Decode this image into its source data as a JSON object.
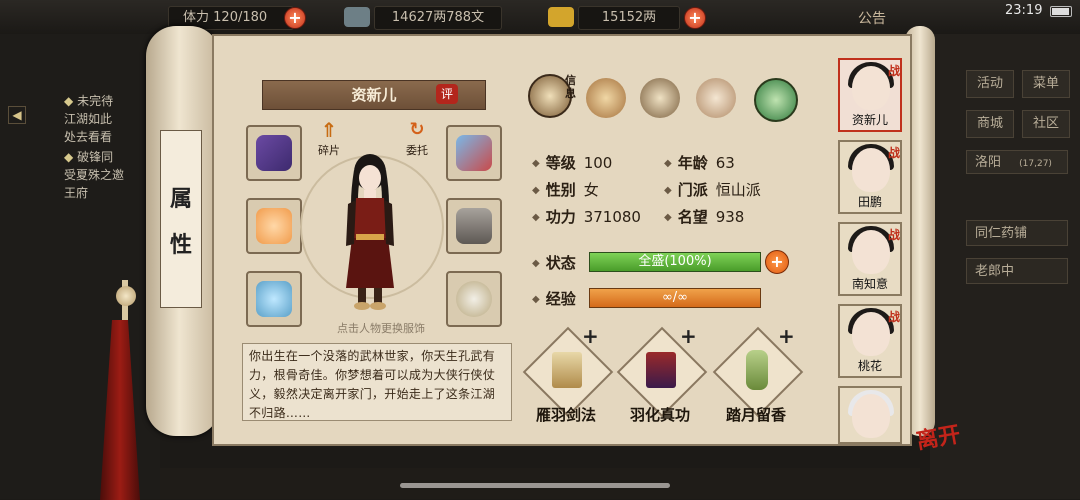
{
  "topbar": {
    "stamina_label": "体力",
    "stamina_value": "120/180",
    "silver_value": "14627两788文",
    "gold_value": "15152两",
    "notice_label": "公告",
    "clock": "23:19"
  },
  "quests": [
    {
      "title": "未完待",
      "desc": [
        "江湖如此",
        "处去看看"
      ]
    },
    {
      "title": "破锋同",
      "desc": [
        "受夏殊之邀",
        "王府"
      ]
    }
  ],
  "side_menu": {
    "activity": "活动",
    "menu": "菜单",
    "mall": "商城",
    "community": "社区",
    "location": "洛阳",
    "coords": "(17,27)",
    "list": [
      "同仁药铺",
      "老郎中"
    ]
  },
  "scroll_tab": {
    "chars": [
      "属",
      "性"
    ]
  },
  "character": {
    "name": "资新儿",
    "eval_label": "评",
    "shard_label": "碎片",
    "entrust_label": "委托",
    "hint": "点击人物更换服饰",
    "story": "你出生在一个没落的武林世家，你天生孔武有力，根骨奇佳。你梦想着可以成为大侠行侠仗义，毅然决定离开家门，开始走上了这条江湖不归路……"
  },
  "tabs": {
    "info_label": "信息"
  },
  "stats": {
    "level_label": "等级",
    "level": "100",
    "age_label": "年龄",
    "age": "63",
    "gender_label": "性别",
    "gender": "女",
    "sect_label": "门派",
    "sect": "恒山派",
    "power_label": "功力",
    "power": "371080",
    "fame_label": "名望",
    "fame": "938",
    "status_label": "状态",
    "status_value": "全盛(100%)",
    "status_fraction": 1.0,
    "exp_label": "经验",
    "exp_value": "∞/∞"
  },
  "skills": [
    {
      "name": "雁羽剑法"
    },
    {
      "name": "羽化真功"
    },
    {
      "name": "踏月留香"
    }
  ],
  "party": [
    {
      "name": "资新儿",
      "fight": "战"
    },
    {
      "name": "田鹏",
      "fight": "战"
    },
    {
      "name": "南知意",
      "fight": "战"
    },
    {
      "name": "桃花",
      "fight": "战"
    },
    {
      "name": "",
      "fight": ""
    }
  ],
  "leave_label": "离开",
  "colors": {
    "hp": "#5db23a",
    "exp": "#e37f2a",
    "accent_red": "#c0301c"
  }
}
